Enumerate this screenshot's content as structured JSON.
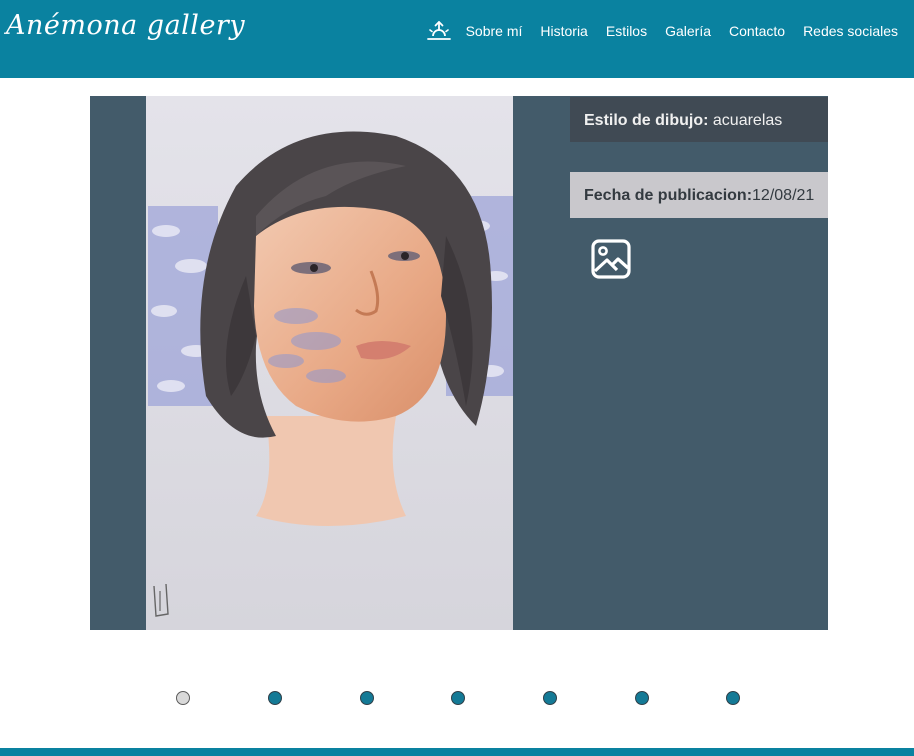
{
  "brand": {
    "logo_text": "Anémona gallery",
    "header_color": "#0a82a0"
  },
  "nav": {
    "home_icon": "sunrise-icon",
    "items": [
      {
        "label": "Sobre mí"
      },
      {
        "label": "Historia"
      },
      {
        "label": "Estilos"
      },
      {
        "label": "Galería"
      },
      {
        "label": "Contacto"
      },
      {
        "label": "Redes sociales"
      }
    ]
  },
  "artwork": {
    "style_label": "Estilo de dibujo:",
    "style_value": "acuarelas",
    "date_label": "Fecha de publicacion:",
    "date_value": "12/08/21",
    "image_icon": "image-icon",
    "card_color": "#435b6a"
  },
  "carousel": {
    "total_slides": 7,
    "active_index": 0,
    "active_color": "#d9d9d9",
    "inactive_color": "#147a96"
  }
}
